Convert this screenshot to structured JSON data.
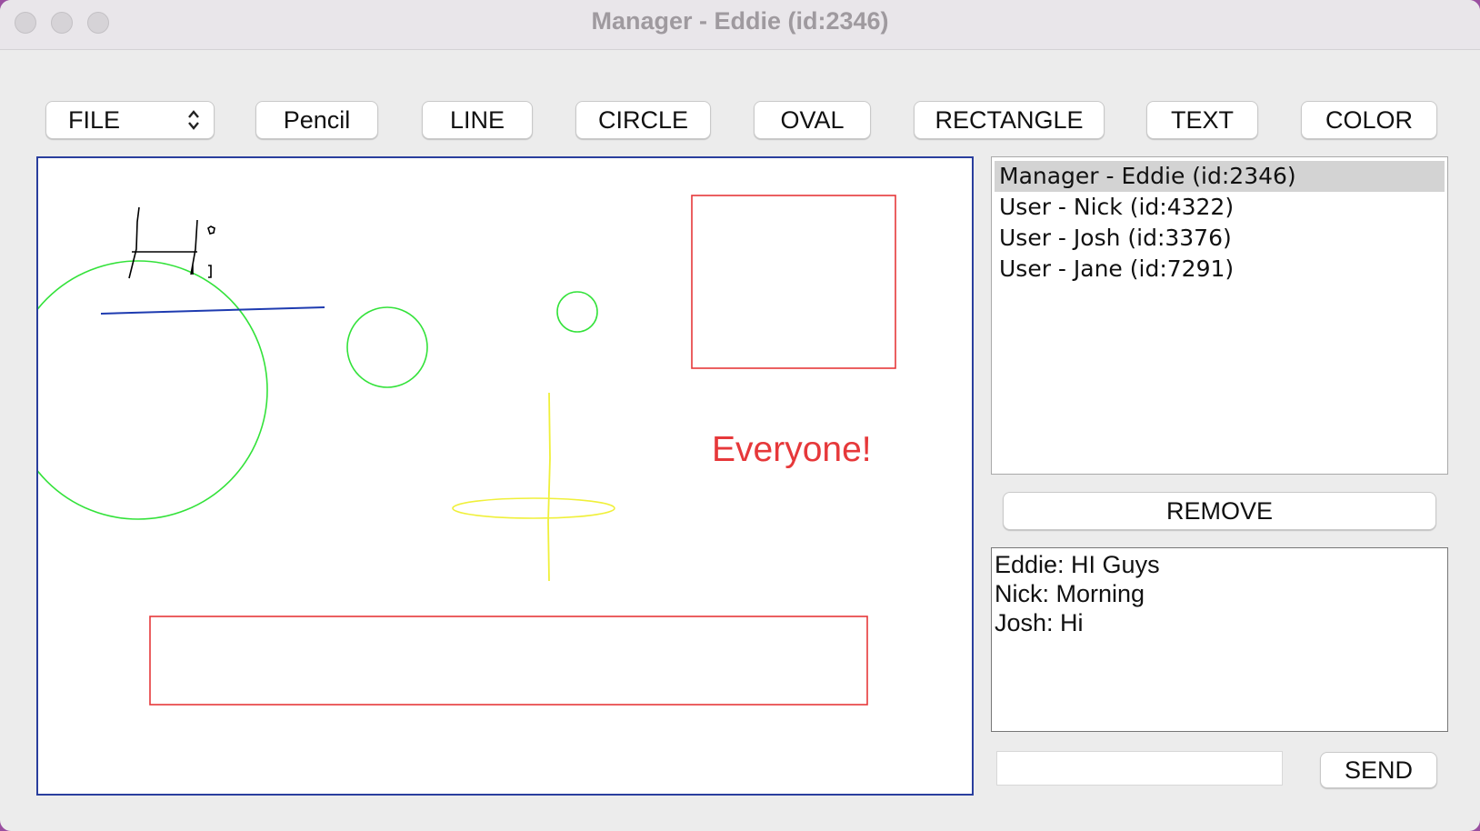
{
  "window": {
    "title": "Manager - Eddie (id:2346)"
  },
  "toolbar": {
    "file_select": {
      "label": "FILE"
    },
    "buttons": [
      "Pencil",
      "LINE",
      "CIRCLE",
      "OVAL",
      "RECTANGLE",
      "TEXT",
      "COLOR"
    ]
  },
  "whiteboard": {
    "text_annotation": "Everyone!",
    "shape_colors": {
      "green": "#33e23a",
      "red": "#e6383a",
      "blue": "#1e3bb0",
      "yellow": "#f0f03a",
      "black": "#000000"
    }
  },
  "users": [
    "Manager - Eddie (id:2346)",
    "User - Nick (id:4322)",
    "User - Josh (id:3376)",
    "User - Jane (id:7291)"
  ],
  "remove_button": "REMOVE",
  "chat": {
    "messages": [
      "Eddie: HI Guys",
      "Nick: Morning",
      "Josh: Hi"
    ],
    "input_value": "",
    "send_button": "SEND"
  },
  "colors": {
    "canvas_border": "#2a3f9e",
    "selected_user_bg": "#d3d3d3"
  }
}
